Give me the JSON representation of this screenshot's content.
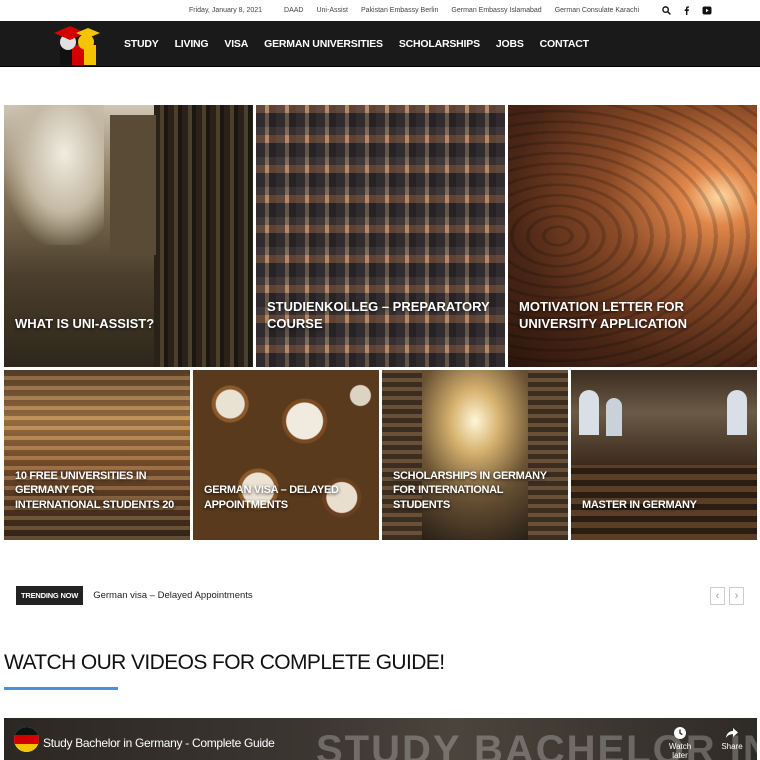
{
  "topbar": {
    "date": "Friday, January 8, 2021",
    "links": [
      "DAAD",
      "Uni-Assist",
      "Pakistan Embassy Berlin",
      "German Embassy Islamabad",
      "German Consulate Karachi"
    ],
    "icons": [
      "search-icon",
      "facebook-icon",
      "youtube-icon"
    ]
  },
  "nav": {
    "items": [
      "STUDY",
      "LIVING",
      "VISA",
      "GERMAN UNIVERSITIES",
      "SCHOLARSHIPS",
      "JOBS",
      "CONTACT"
    ]
  },
  "featured_large": [
    {
      "title": "WHAT IS UNI-ASSIST?"
    },
    {
      "title": "STUDIENKOLLEG – PREPARATORY COURSE"
    },
    {
      "title": "MOTIVATION LETTER FOR UNIVERSITY APPLICATION"
    }
  ],
  "featured_small": [
    {
      "title": "10 FREE UNIVERSITIES IN GERMANY FOR INTERNATIONAL STUDENTS 20"
    },
    {
      "title": "GERMAN VISA – DELAYED APPOINTMENTS"
    },
    {
      "title": "SCHOLARSHIPS IN GERMANY FOR INTERNATIONAL STUDENTS"
    },
    {
      "title": "MASTER IN GERMANY"
    }
  ],
  "trending": {
    "badge": "TRENDING NOW",
    "text": "German visa – Delayed Appointments"
  },
  "videos": {
    "heading": "WATCH OUR VIDEOS FOR COMPLETE GUIDE!",
    "accent": "#4a90e2",
    "video_title": "Study Bachelor in Germany - Complete Guide",
    "overlay_text": "STUDY BACHELOR IN",
    "watch_later": "Watch later",
    "share": "Share"
  }
}
